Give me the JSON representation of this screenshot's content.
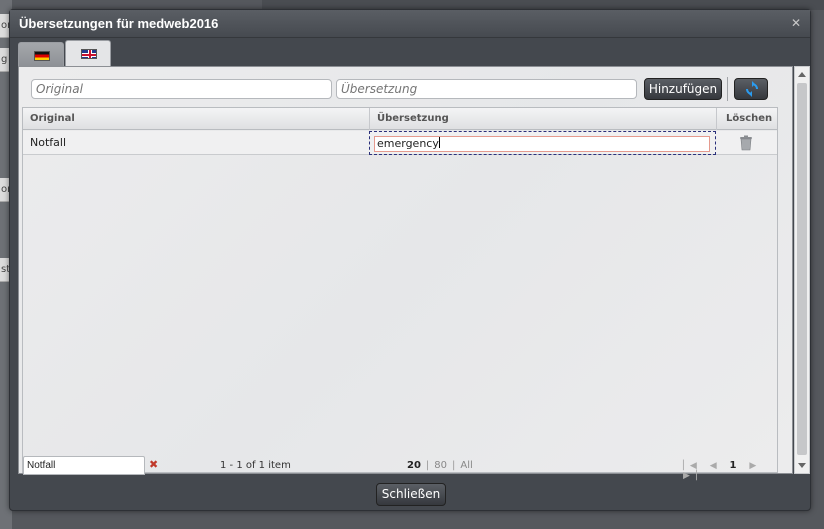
{
  "dialog": {
    "title": "Übersetzungen für medweb2016"
  },
  "tabs": [
    {
      "label": "",
      "flag": "german-flag-icon"
    },
    {
      "label": "",
      "flag": "british-flag-icon"
    }
  ],
  "form": {
    "original_placeholder": "Original",
    "translation_placeholder": "Übersetzung",
    "add_label": "Hinzufügen"
  },
  "grid": {
    "columns": [
      "Original",
      "Übersetzung",
      "Löschen"
    ],
    "rows": [
      {
        "original": "Notfall",
        "translation": "emergency"
      }
    ]
  },
  "pager": {
    "filter_value": "Notfall",
    "count": "1 - 1 of 1 item",
    "page_sizes": [
      "20",
      "80",
      "All"
    ],
    "selected_size": "20",
    "page": "1"
  },
  "footer": {
    "close_label": "Schließen"
  },
  "colors": {
    "accent_blue": "#1f8fe0",
    "error_red": "#c0392b"
  },
  "background": {
    "frag_1": "on",
    "frag_2": "g",
    "frag_3": "on",
    "frag_4": "ste"
  }
}
